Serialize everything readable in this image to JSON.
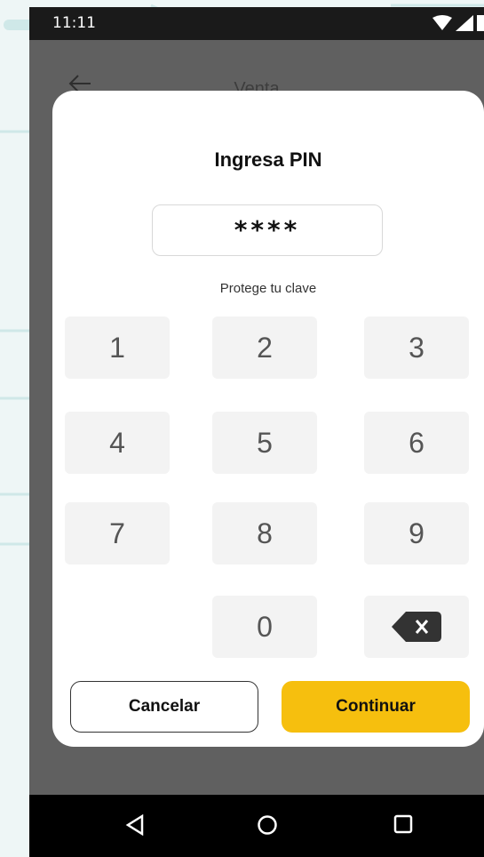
{
  "status_bar": {
    "time": "11:11"
  },
  "app_bar": {
    "title": "Venta"
  },
  "pin_dialog": {
    "title": "Ingresa PIN",
    "pin_value": "****",
    "hint": "Protege tu clave",
    "keys": [
      "1",
      "2",
      "3",
      "4",
      "5",
      "6",
      "7",
      "8",
      "9",
      "0"
    ],
    "cancel_label": "Cancelar",
    "continue_label": "Continuar"
  },
  "colors": {
    "accent": "#F6BF0E",
    "key_bg": "#f3f3f3",
    "overlay": "#606060"
  },
  "icons": [
    "back-arrow-icon",
    "wifi-icon",
    "signal-icon",
    "battery-icon",
    "backspace-icon",
    "nav-back-icon",
    "nav-home-icon",
    "nav-recents-icon"
  ]
}
